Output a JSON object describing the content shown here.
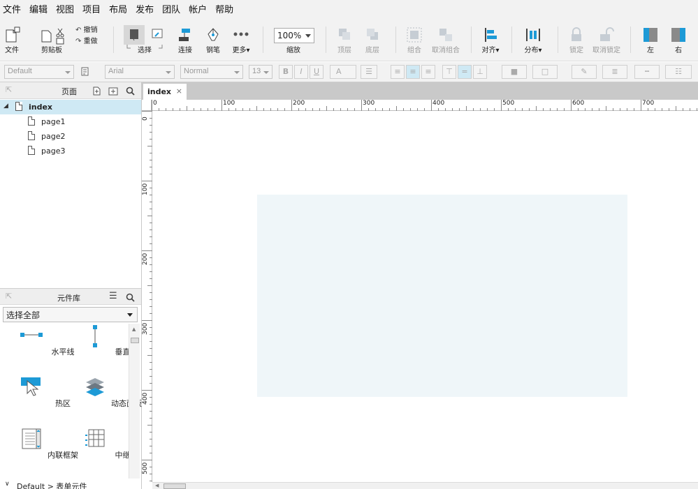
{
  "menu": [
    "文件",
    "编辑",
    "视图",
    "项目",
    "布局",
    "发布",
    "团队",
    "帐户",
    "帮助"
  ],
  "toolbar": {
    "file": "文件",
    "clipboard": "剪贴板",
    "undo": "撤销",
    "redo": "重做",
    "select": "选择",
    "connect": "连接",
    "pen": "钢笔",
    "more": "更多▾",
    "zoom_value": "100%",
    "zoom": "缩放",
    "top_layer": "顶层",
    "bottom_layer": "底层",
    "group": "组合",
    "ungroup": "取消组合",
    "align": "对齐▾",
    "distribute": "分布▾",
    "lock": "锁定",
    "unlock": "取消锁定",
    "left": "左",
    "right": "右"
  },
  "format": {
    "style": "Default",
    "font": "Arial",
    "weight": "Normal",
    "size": "13",
    "bold": "B",
    "italic": "I",
    "underline": "U",
    "font_color": "A"
  },
  "pages_panel": {
    "title": "页面",
    "root": "index",
    "children": [
      "page1",
      "page2",
      "page3"
    ]
  },
  "library_panel": {
    "title": "元件库",
    "selected": "选择全部",
    "widgets": [
      "水平线",
      "垂直线",
      "热区",
      "动态面板",
      "内联框架",
      "中继器"
    ],
    "footer": "Default > 表单元件"
  },
  "tab": {
    "label": "index",
    "close": "×"
  },
  "ruler": {
    "h_labels": [
      "0",
      "100",
      "200",
      "300",
      "400",
      "500",
      "600",
      "700"
    ],
    "v_labels": [
      "0",
      "100",
      "200",
      "300",
      "400",
      "500"
    ]
  },
  "colors": {
    "accent": "#1d9ad6",
    "selection": "#cfe9f4",
    "widget_fill": "#eff6f9"
  }
}
